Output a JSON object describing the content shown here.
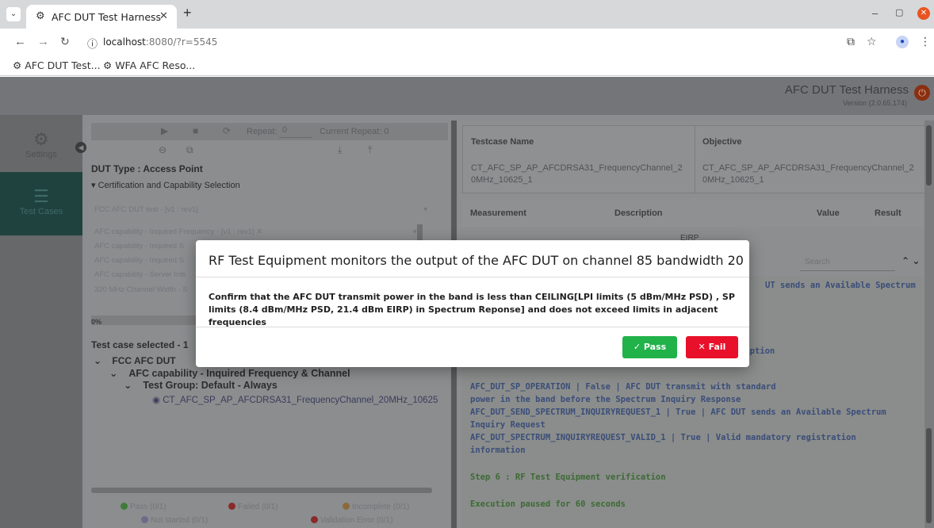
{
  "browser": {
    "tab_title": "AFC DUT Test Harness",
    "url_host": "localhost",
    "url_rest": ":8080/?r=5545",
    "bookmarks": [
      "AFC DUT Test...",
      "WFA AFC Reso..."
    ]
  },
  "app": {
    "title": "AFC DUT Test Harness",
    "version": "Version (2.0.65.174)"
  },
  "sidebar": {
    "items": [
      {
        "label": "Settings",
        "icon": "gear-icon"
      },
      {
        "label": "Test Cases",
        "icon": "list-icon"
      }
    ]
  },
  "left": {
    "repeat_label": "Repeat:",
    "repeat_value": "0",
    "current_repeat": "Current Repeat: 0",
    "dut_type": "DUT Type : Access Point",
    "cert_section": "Certification and Capability Selection",
    "selects": [
      "FCC AFC DUT test - [v1 : rev1]",
      "AFC capability - Inquired Frequency - [v1 : rev1]",
      "AFC capability - Inquired S",
      "AFC capability - Inquired S",
      "AFC capability - Server Initi",
      "320 MHz Channel Width - S"
    ],
    "progress": "0%",
    "tc_selected": "Test case selected - 1",
    "tree": {
      "level1": "FCC AFC DUT",
      "level2": "AFC capability - Inquired Frequency & Channel",
      "level3": "Test Group: Default - Always",
      "leaf": "CT_AFC_SP_AP_AFCDRSA31_FrequencyChannel_20MHz_10625"
    },
    "stats": {
      "pass": "Pass (0/1)",
      "failed": "Failed (0/1)",
      "incomplete": "Incomplete (0/1)",
      "not_started": "Not started (0/1)",
      "validation_error": "Validation Error (0/1)"
    }
  },
  "right": {
    "tc_name_header": "Testcase Name",
    "tc_name_value": "CT_AFC_SP_AP_AFCDRSA31_FrequencyChannel_20MHz_10625_1",
    "objective_header": "Objective",
    "objective_value": "CT_AFC_SP_AP_AFCDRSA31_FrequencyChannel_20MHz_10625_1",
    "measurement_headers": [
      "Measurement",
      "Description",
      "Value",
      "Result"
    ],
    "measurement_value": "EIRP",
    "search_placeholder": "Search",
    "log_partial_1": "UT sends an Available Spectrum",
    "log_partial_2": "ription",
    "log_lines": [
      "AFC_DUT_SP_OPERATION                | False | AFC DUT transmit with standard",
      "power in the band before the Spectrum Inquiry Response",
      "AFC_DUT_SEND_SPECTRUM_INQUIRYREQUEST_1  | True  | AFC DUT sends an Available Spectrum",
      "Inquiry Request",
      "AFC_DUT_SPECTRUM_INQUIRYREQUEST_VALID_1 | True  | Valid mandatory registration",
      "information"
    ],
    "step": "Step 6 : RF Test Equipment verification",
    "paused": "Execution paused for 60 seconds"
  },
  "modal": {
    "title": "RF Test Equipment monitors the output of the AFC DUT on channel 85 bandwidth 20",
    "body": "Confirm that the AFC DUT transmit power in the band is less than CEILING[LPI limits (5 dBm/MHz PSD) , SP limits (8.4 dBm/MHz PSD, 21.4 dBm EIRP) in Spectrum Reponse] and does not exceed limits in adjacent frequencies",
    "pass_label": "Pass",
    "fail_label": "Fail"
  },
  "colors": {
    "pass": "#21b24a",
    "fail": "#e8102a",
    "sidebar_active": "#20423f",
    "window_close": "#e95420"
  }
}
